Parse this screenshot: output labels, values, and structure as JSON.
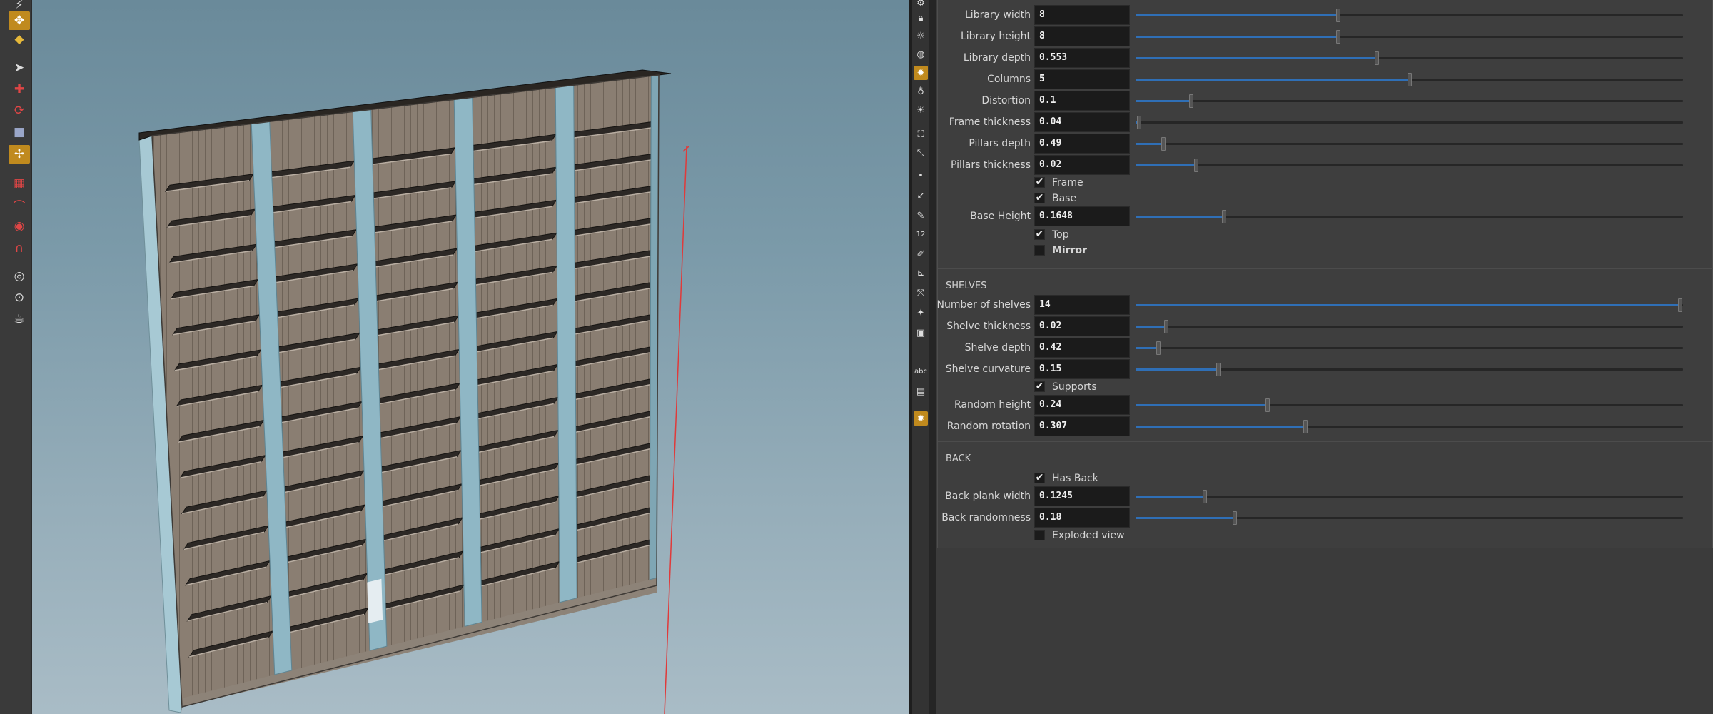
{
  "panel": {
    "sections": {
      "shelves": "SHELVES",
      "back": "BACK"
    },
    "params": {
      "library_width": {
        "label": "Library width",
        "value": "8",
        "fraction": 0.37
      },
      "library_height": {
        "label": "Library height",
        "value": "8",
        "fraction": 0.37
      },
      "library_depth": {
        "label": "Library depth",
        "value": "0.553",
        "fraction": 0.44
      },
      "columns": {
        "label": "Columns",
        "value": "5",
        "fraction": 0.5
      },
      "distortion": {
        "label": "Distortion",
        "value": "0.1",
        "fraction": 0.1
      },
      "frame_thickness": {
        "label": "Frame thickness",
        "value": "0.04",
        "fraction": 0.005
      },
      "pillars_depth": {
        "label": "Pillars depth",
        "value": "0.49",
        "fraction": 0.05
      },
      "pillars_thickness": {
        "label": "Pillars thickness",
        "value": "0.02",
        "fraction": 0.11
      },
      "base_height": {
        "label": "Base Height",
        "value": "0.1648",
        "fraction": 0.16
      },
      "number_of_shelves": {
        "label": "Number of shelves",
        "value": "14",
        "fraction": 0.995
      },
      "shelve_thickness": {
        "label": "Shelve thickness",
        "value": "0.02",
        "fraction": 0.055
      },
      "shelve_depth": {
        "label": "Shelve depth",
        "value": "0.42",
        "fraction": 0.04
      },
      "shelve_curvature": {
        "label": "Shelve curvature",
        "value": "0.15",
        "fraction": 0.15
      },
      "random_height": {
        "label": "Random height",
        "value": "0.24",
        "fraction": 0.24
      },
      "random_rotation": {
        "label": "Random rotation",
        "value": "0.307",
        "fraction": 0.31
      },
      "back_plank_width": {
        "label": "Back plank width",
        "value": "0.1245",
        "fraction": 0.125
      },
      "back_randomness": {
        "label": "Back randomness",
        "value": "0.18",
        "fraction": 0.18
      }
    },
    "toggles": {
      "frame": {
        "label": "Frame",
        "checked": true
      },
      "base": {
        "label": "Base",
        "checked": true
      },
      "top": {
        "label": "Top",
        "checked": true
      },
      "mirror": {
        "label": "Mirror",
        "checked": false
      },
      "supports": {
        "label": "Supports",
        "checked": true
      },
      "has_back": {
        "label": "Has Back",
        "checked": true
      },
      "exploded": {
        "label": "Exploded view",
        "checked": false
      }
    }
  },
  "left_toolbar": {
    "icons": [
      "light-icon",
      "handles-icon",
      "pose-icon",
      "select-arrow-icon",
      "transform-icon",
      "rotate-icon",
      "scale-icon",
      "pivot-icon",
      "transform-tool-icon",
      "snap-grid-icon",
      "snap-curve-icon",
      "snap-point-icon",
      "magnet-icon",
      "view-camera-icon",
      "flipbook-icon",
      "render-icon"
    ]
  },
  "shelf_tools": {
    "icons": [
      "settings-icon",
      "lock-icon",
      "light-bulb-icon",
      "sphere-icon",
      "light-active-icon",
      "spot-light-icon",
      "area-light-icon",
      "geo-light-icon",
      "env-light-icon",
      "camera-icon",
      "point-icon",
      "edge-icon",
      "brush-icon",
      "number-icon",
      "paint-icon",
      "measure-icon",
      "vector-icon",
      "joint-icon",
      "box-icon",
      "text-abc-icon",
      "display-icon",
      "light-selected-icon"
    ],
    "number_label": "12",
    "abc_label": "abc"
  },
  "colors": {
    "accent": "#c08a1e",
    "slider_fill": "#2f6fb6",
    "guide_line": "#e03a3a"
  }
}
